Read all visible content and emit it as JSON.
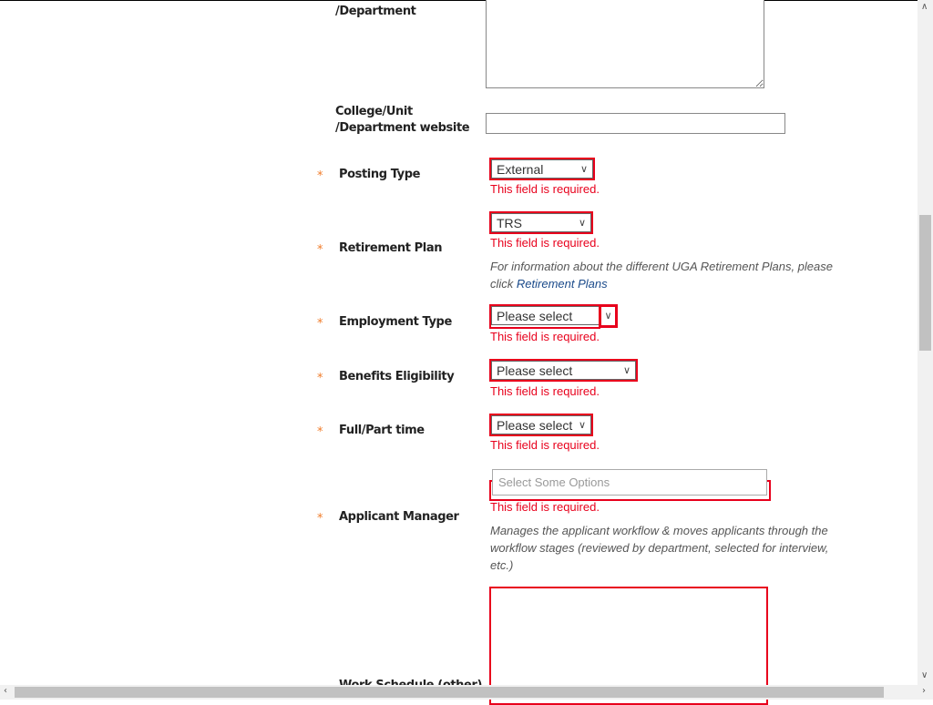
{
  "fields": {
    "dept_label": "/Department",
    "website_label_1": "College/Unit",
    "website_label_2": "/Department website",
    "posting_type": {
      "label": "Posting Type",
      "value": "External"
    },
    "retirement_plan": {
      "label": "Retirement Plan",
      "value": "TRS",
      "help": "For information about the different UGA Retirement Plans, please click",
      "link": "Retirement Plans"
    },
    "employment_type": {
      "label": "Employment Type",
      "value": "Please select"
    },
    "benefits": {
      "label": "Benefits Eligibility",
      "value": "Please select"
    },
    "full_part": {
      "label": "Full/Part time",
      "value": "Please select"
    },
    "applicant_manager": {
      "label": "Applicant Manager",
      "placeholder": "Select Some Options",
      "help": "Manages the applicant workflow & moves applicants through the workflow stages (reviewed by department, selected for interview, etc.)"
    },
    "work_schedule": {
      "label": "Work Schedule (other)"
    }
  },
  "required_star": "*",
  "error_text": "This field is required.",
  "colors": {
    "error": "#e8001c",
    "required": "#f07c2a",
    "link": "#1a4a8a"
  }
}
